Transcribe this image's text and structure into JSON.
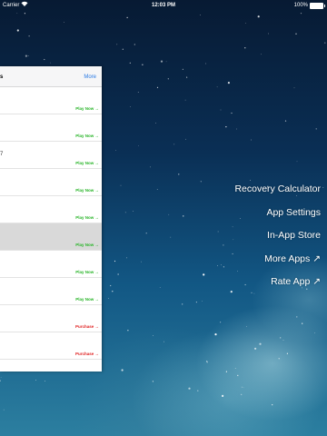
{
  "status_bar": {
    "carrier": "Carrier",
    "time": "12:03 PM",
    "battery": "100%"
  },
  "panel": {
    "header_title": "s",
    "more_label": "More",
    "rows": [
      {
        "label": "",
        "action": "Play Now →",
        "kind": "play",
        "selected": false
      },
      {
        "label": "",
        "action": "Play Now →",
        "kind": "play",
        "selected": false
      },
      {
        "label": "7",
        "action": "Play Now →",
        "kind": "play",
        "selected": false
      },
      {
        "label": "",
        "action": "Play Now →",
        "kind": "play",
        "selected": false
      },
      {
        "label": "",
        "action": "Play Now →",
        "kind": "play",
        "selected": false
      },
      {
        "label": "",
        "action": "Play Now →",
        "kind": "play",
        "selected": true
      },
      {
        "label": "",
        "action": "Play Now →",
        "kind": "play",
        "selected": false
      },
      {
        "label": "",
        "action": "Play Now →",
        "kind": "play",
        "selected": false
      },
      {
        "label": "",
        "action": "Purchase →",
        "kind": "purchase",
        "selected": false
      },
      {
        "label": "",
        "action": "Purchase →",
        "kind": "purchase",
        "selected": false
      }
    ]
  },
  "menu": {
    "items": [
      {
        "label": "Recovery Calculator",
        "name": "menu-recovery-calculator"
      },
      {
        "label": "App Settings",
        "name": "menu-app-settings"
      },
      {
        "label": "In-App Store",
        "name": "menu-in-app-store"
      },
      {
        "label": "More Apps ↗",
        "name": "menu-more-apps"
      },
      {
        "label": "Rate App ↗",
        "name": "menu-rate-app"
      }
    ]
  },
  "colors": {
    "play": "#2ab52a",
    "purchase": "#e02020",
    "link": "#2c7be5"
  }
}
